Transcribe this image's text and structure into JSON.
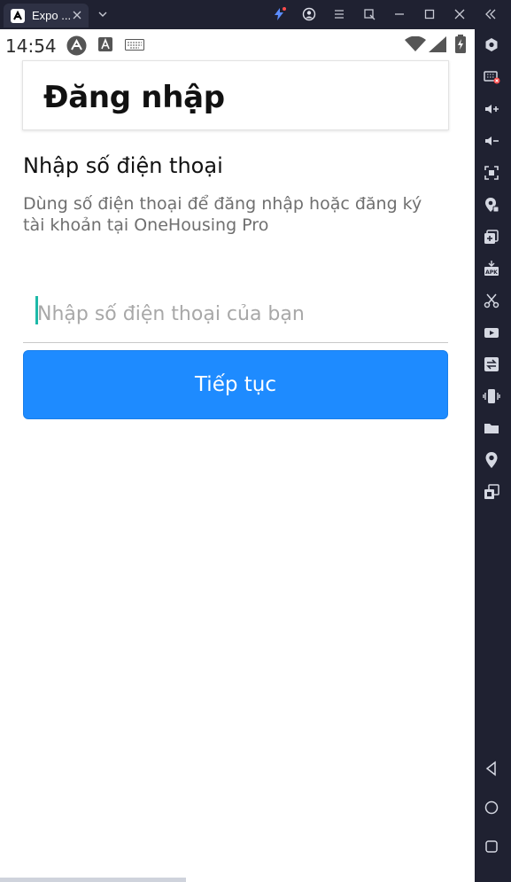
{
  "window": {
    "tab_title": "Expo ...",
    "tab_icon": "expo-icon",
    "toolbar_icons": [
      "chevron-down-icon",
      "bolt-icon",
      "account-icon",
      "menu-icon",
      "popout-icon",
      "minimize-icon",
      "maximize-icon",
      "close-icon",
      "collapse-sidebar-icon"
    ]
  },
  "statusbar": {
    "time": "14:54",
    "icons": [
      "expo-go-icon",
      "accessibility-icon",
      "keyboard-icon",
      "wifi-icon",
      "signal-icon",
      "battery-icon"
    ]
  },
  "header": {
    "title": "Đăng nhập"
  },
  "login": {
    "section_title": "Nhập số điện thoại",
    "description": "Dùng số điện thoại để đăng nhập hoặc đăng ký tài khoản tại OneHousing Pro",
    "phone_value": "",
    "phone_placeholder": "Nhập số điện thoại của bạn",
    "continue_label": "Tiếp tục"
  },
  "emulator_sidebar": {
    "items": [
      "settings-icon",
      "keyboard-off-icon",
      "volume-up-icon",
      "volume-down-icon",
      "screenshot-icon",
      "location-lock-icon",
      "multi-window-icon",
      "apk-install-icon",
      "cut-icon",
      "record-video-icon",
      "sync-icon",
      "shake-icon",
      "folder-icon",
      "location-icon",
      "multi-instance-icon",
      "back-icon",
      "home-icon",
      "recents-icon"
    ]
  },
  "colors": {
    "accent": "#1e8bff",
    "caret": "#1db9a8",
    "frame": "#1f2131"
  }
}
